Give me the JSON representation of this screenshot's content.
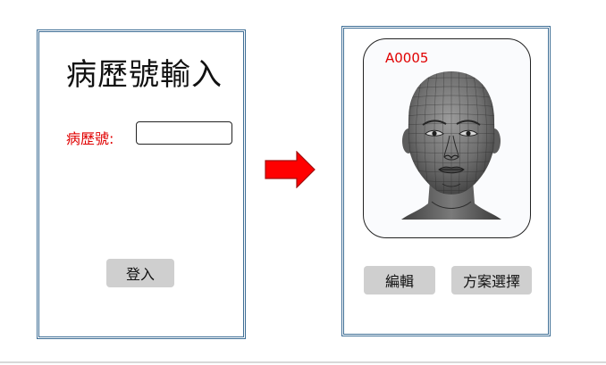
{
  "login_screen": {
    "title": "病歷號輸入",
    "field_label": "病歷號:",
    "field_value": "",
    "login_button": "登入"
  },
  "patient_screen": {
    "patient_id": "A0005",
    "edit_button": "編輯",
    "plan_button": "方案選擇"
  },
  "icons": {
    "transition_arrow": "right-arrow-icon",
    "model": "3d-face-model"
  },
  "colors": {
    "frame_border": "#3f6f96",
    "label_red": "#e00000",
    "arrow_red": "#ff0000",
    "button_gray": "#cfcfcf"
  }
}
